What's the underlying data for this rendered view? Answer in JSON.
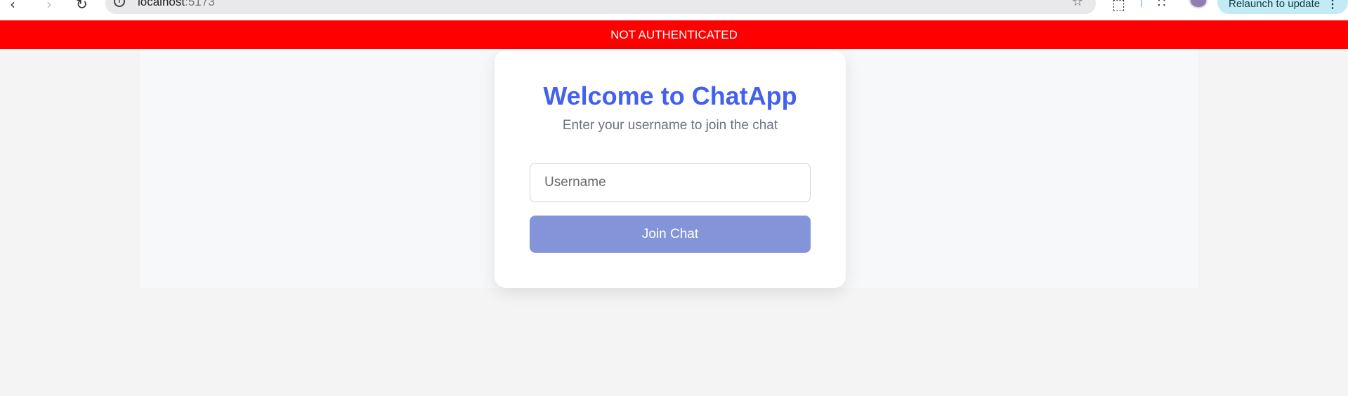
{
  "browser": {
    "url_host": "localhost",
    "url_port": ":5173",
    "update_button_label": "Relaunch to update",
    "icons": [
      "back-icon",
      "forward-icon",
      "reload-icon",
      "site-info-icon",
      "bookmark-star-icon",
      "extensions-icon",
      "cast-icon",
      "profile-avatar",
      "more-menu-icon"
    ]
  },
  "status_banner": {
    "text": "NOT AUTHENTICATED",
    "color": "#ff0000"
  },
  "login_card": {
    "title": "Welcome to ChatApp",
    "subtitle": "Enter your username to join the chat",
    "username_placeholder": "Username",
    "username_value": "",
    "join_button_label": "Join Chat"
  },
  "colors": {
    "accent": "#4361ee",
    "button": "#8394d8",
    "page_background": "#f4f4f4"
  }
}
